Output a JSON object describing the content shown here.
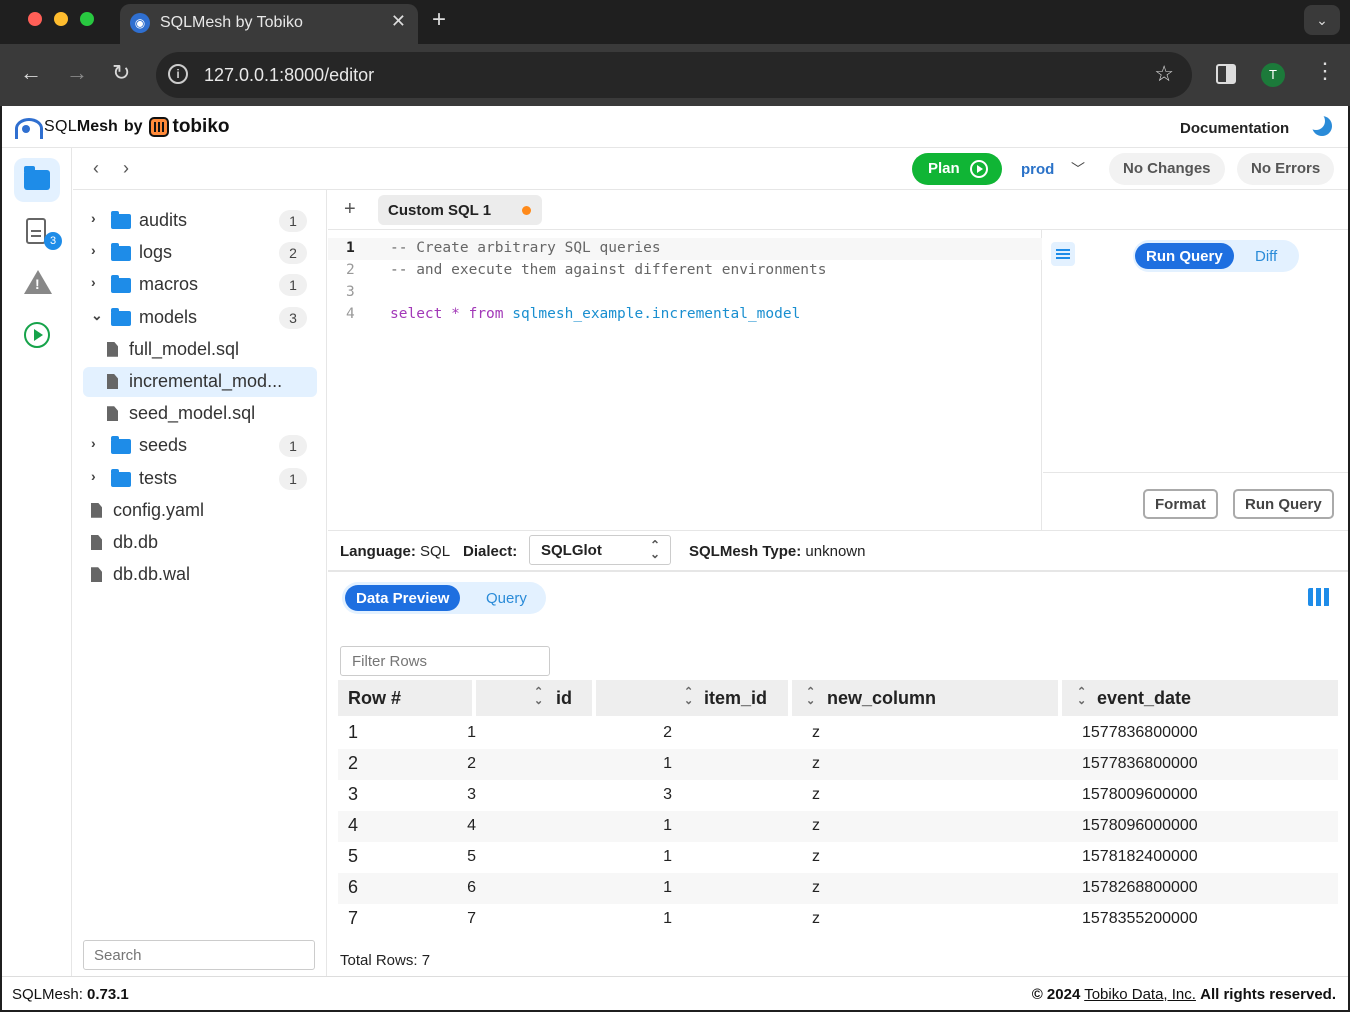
{
  "browser": {
    "tab_title": "SQLMesh by Tobiko",
    "tab_close": "✕",
    "new_tab": "+",
    "url": "127.0.0.1:8000/editor",
    "profile_initial": "T"
  },
  "header": {
    "logo_sql": "SQL",
    "logo_mesh": "Mesh",
    "logo_by": "by",
    "logo_tobiko": "tobiko",
    "documentation": "Documentation"
  },
  "rail": {
    "file_badge": "3"
  },
  "toolbar": {
    "plan_label": "Plan",
    "environment": "prod",
    "changes_status": "No Changes",
    "errors_status": "No Errors"
  },
  "tree": {
    "items": [
      {
        "type": "folder",
        "label": "audits",
        "count": "1",
        "expanded": false
      },
      {
        "type": "folder",
        "label": "logs",
        "count": "2",
        "expanded": false
      },
      {
        "type": "folder",
        "label": "macros",
        "count": "1",
        "expanded": false
      },
      {
        "type": "folder",
        "label": "models",
        "count": "3",
        "expanded": true
      },
      {
        "type": "file",
        "label": "full_model.sql",
        "indent": 1
      },
      {
        "type": "file",
        "label": "incremental_mod...",
        "indent": 1,
        "selected": true
      },
      {
        "type": "file",
        "label": "seed_model.sql",
        "indent": 1
      },
      {
        "type": "folder",
        "label": "seeds",
        "count": "1",
        "expanded": false
      },
      {
        "type": "folder",
        "label": "tests",
        "count": "1",
        "expanded": false
      },
      {
        "type": "file",
        "label": "config.yaml",
        "indent": 0
      },
      {
        "type": "file",
        "label": "db.db",
        "indent": 0
      },
      {
        "type": "file",
        "label": "db.db.wal",
        "indent": 0
      }
    ],
    "search_placeholder": "Search"
  },
  "editor": {
    "add_tab": "+",
    "tab_label": "Custom SQL 1",
    "lines": [
      {
        "num": "1",
        "comment": "-- Create arbitrary SQL queries"
      },
      {
        "num": "2",
        "comment": "-- and execute them against different environments"
      },
      {
        "num": "3",
        "comment": ""
      },
      {
        "num": "4",
        "kw1": "select",
        "op": " * ",
        "kw2": "from",
        "ident": " sqlmesh_example.incremental_model"
      }
    ]
  },
  "right_panel": {
    "run_query_tab": "Run Query",
    "diff_tab": "Diff",
    "format_button": "Format",
    "run_query_button": "Run Query"
  },
  "lang_bar": {
    "language_label": "Language:",
    "language_value": "SQL",
    "dialect_label": "Dialect:",
    "dialect_value": "SQLGlot",
    "type_label": "SQLMesh Type:",
    "type_value": "unknown"
  },
  "results": {
    "data_preview_tab": "Data Preview",
    "query_tab": "Query",
    "filter_placeholder": "Filter Rows",
    "columns": [
      "Row #",
      "id",
      "item_id",
      "new_column",
      "event_date"
    ],
    "rows": [
      [
        "1",
        "1",
        "2",
        "z",
        "1577836800000"
      ],
      [
        "2",
        "2",
        "1",
        "z",
        "1577836800000"
      ],
      [
        "3",
        "3",
        "3",
        "z",
        "1578009600000"
      ],
      [
        "4",
        "4",
        "1",
        "z",
        "1578096000000"
      ],
      [
        "5",
        "5",
        "1",
        "z",
        "1578182400000"
      ],
      [
        "6",
        "6",
        "1",
        "z",
        "1578268800000"
      ],
      [
        "7",
        "7",
        "1",
        "z",
        "1578355200000"
      ]
    ],
    "total_rows": "Total Rows: 7"
  },
  "footer": {
    "version_label": "SQLMesh:",
    "version_value": "0.73.1",
    "copyright_prefix": "© 2024",
    "company_link": "Tobiko Data, Inc.",
    "rights": "All rights reserved."
  },
  "colors": {
    "accent": "#1e6fe0",
    "plan_green": "#10b535",
    "folder_blue": "#1e8ce8",
    "unsaved_dot": "#ff8a1a"
  }
}
